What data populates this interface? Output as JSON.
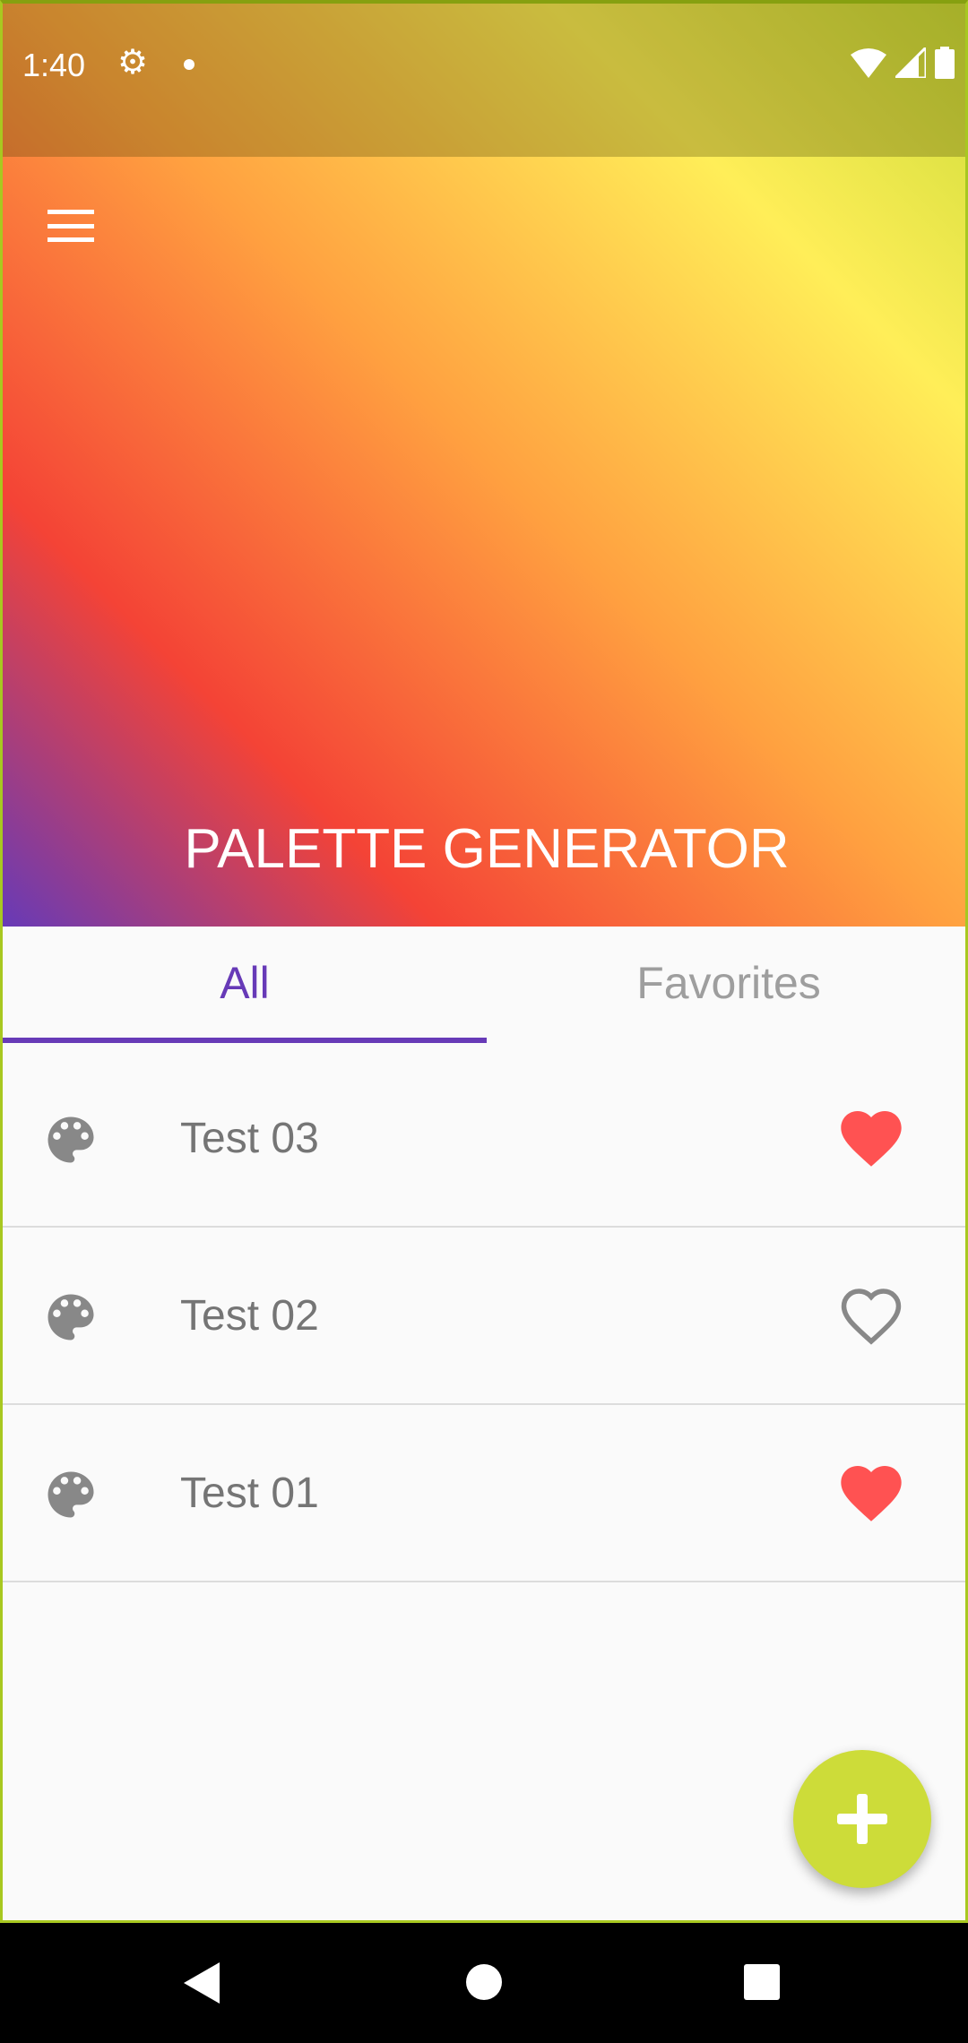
{
  "status_bar": {
    "time": "1:40"
  },
  "header": {
    "title": "PALETTE GENERATOR"
  },
  "tabs": [
    {
      "label": "All",
      "selected": true
    },
    {
      "label": "Favorites",
      "selected": false
    }
  ],
  "palettes": [
    {
      "name": "Test 03",
      "favorite": true
    },
    {
      "name": "Test 02",
      "favorite": false
    },
    {
      "name": "Test 01",
      "favorite": true
    }
  ],
  "colors": {
    "accent": "#673ab7",
    "heart": "#ff5252",
    "fab": "#cddc39"
  }
}
